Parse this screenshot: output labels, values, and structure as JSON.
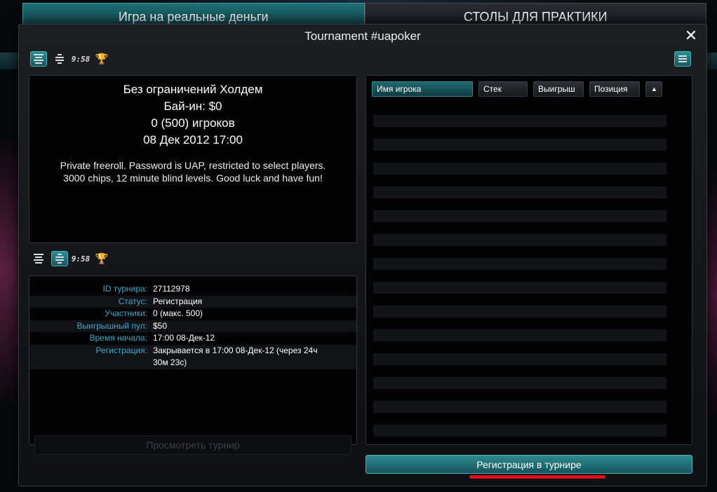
{
  "lobby": {
    "tabs": [
      "Игра на реальные деньги",
      "СТОЛЫ ДЛЯ ПРАКТИКИ"
    ]
  },
  "dialog": {
    "title": "Tournament #uapoker",
    "close_label": "✕"
  },
  "tournament": {
    "game": "Без ограничений Холдем",
    "buyin": "Бай-ин: $0",
    "players": "0 (500) игроков",
    "start": "08 Дек 2012 17:00",
    "description": "Private freeroll. Password is UAP, restricted to select players. 3000 chips, 12 minute blind levels. Good luck and have fun!"
  },
  "icons": {
    "clock_digits": "9:58",
    "trophy": "🏆"
  },
  "details": [
    {
      "label": "ID турнира:",
      "value": "27112978"
    },
    {
      "label": "Статус:",
      "value": "Регистрация"
    },
    {
      "label": "Участники:",
      "value": "0 (макс. 500)"
    },
    {
      "label": "Выигрышный пул:",
      "value": "$50"
    },
    {
      "label": "Время начала:",
      "value": "17:00 08-Дек-12"
    },
    {
      "label": "Регистрация:",
      "value": "Закрывается в 17:00 08-Дек-12 (через 24ч 30м 23с)"
    }
  ],
  "players_table": {
    "columns": [
      "Имя игрока",
      "Стек",
      "Выигрыш",
      "Позиция",
      "▲"
    ]
  },
  "buttons": {
    "view_tournament": "Просмотреть турнир",
    "register": "Регистрация в турнире"
  },
  "colors": {
    "accent": "#2e8a90",
    "label_blue": "#3aa8c8",
    "highlight": "#e0101a"
  }
}
